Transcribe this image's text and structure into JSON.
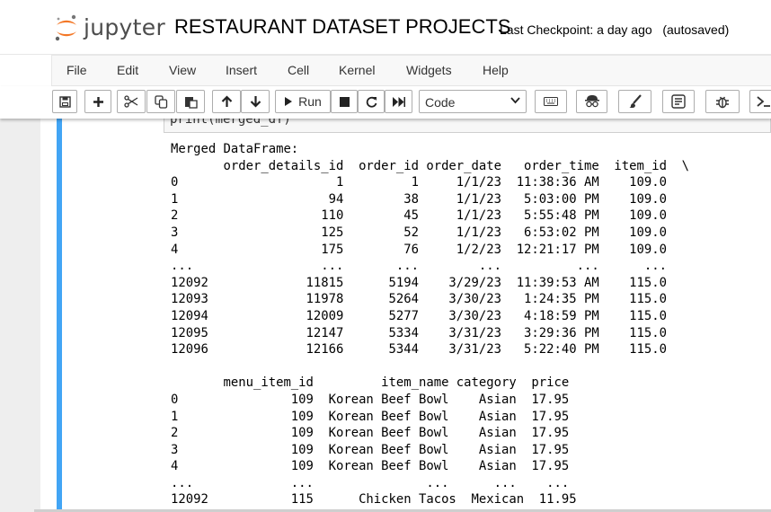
{
  "header": {
    "logo_text": "jupyter",
    "notebook_title": "RESTAURANT DATASET PROJECTS",
    "checkpoint": "Last Checkpoint: a day ago",
    "autosave_status": "(autosaved)"
  },
  "menu": [
    "File",
    "Edit",
    "View",
    "Insert",
    "Cell",
    "Kernel",
    "Widgets",
    "Help"
  ],
  "toolbar": {
    "buttons": [
      "save-icon",
      "plus-icon",
      "cut-icon",
      "copy-icon",
      "paste-icon",
      "arrow-up-icon",
      "arrow-down-icon",
      "run-icon",
      "stop-icon",
      "restart-icon",
      "fast-forward-icon",
      "keyboard-icon",
      "incognito-icon",
      "paintbrush-icon",
      "document-icon",
      "bug-icon",
      "terminal-icon"
    ],
    "run_label": "Run",
    "cell_type": "Code"
  },
  "cell": {
    "code_fragment": "print(merged_df)",
    "output": "Merged DataFrame:\n       order_details_id  order_id order_date   order_time  item_id  \\\n0                     1         1     1/1/23  11:38:36 AM    109.0   \n1                    94        38     1/1/23   5:03:00 PM    109.0   \n2                   110        45     1/1/23   5:55:48 PM    109.0   \n3                   125        52     1/1/23   6:53:02 PM    109.0   \n4                   175        76     1/2/23  12:21:17 PM    109.0   \n...                 ...       ...        ...          ...      ...   \n12092             11815      5194    3/29/23  11:39:53 AM    115.0   \n12093             11978      5264    3/30/23   1:24:35 PM    115.0   \n12094             12009      5277    3/30/23   4:18:59 PM    115.0   \n12095             12147      5334    3/31/23   3:29:36 PM    115.0   \n12096             12166      5344    3/31/23   5:22:40 PM    115.0   \n\n       menu_item_id         item_name category  price  \n0               109  Korean Beef Bowl    Asian  17.95  \n1               109  Korean Beef Bowl    Asian  17.95  \n2               109  Korean Beef Bowl    Asian  17.95  \n3               109  Korean Beef Bowl    Asian  17.95  \n4               109  Korean Beef Bowl    Asian  17.95  \n...             ...               ...      ...    ...  \n12092           115      Chicken Tacos  Mexican  11.95  "
  },
  "colors": {
    "accent_cell_bar": "#42a5f5",
    "logo_orange": "#f37726",
    "logo_gray": "#4d4d4d"
  }
}
